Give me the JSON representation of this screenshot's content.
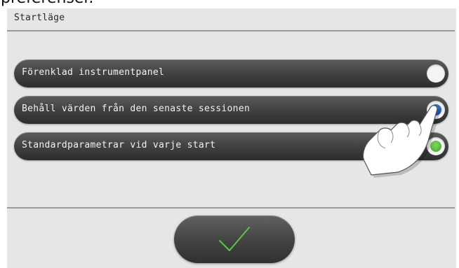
{
  "caption_fragment": "preferenser.",
  "panel": {
    "title": "Startläge"
  },
  "options": [
    {
      "label": "Förenklad instrumentpanel",
      "state": "unselected"
    },
    {
      "label": "Behåll värden från den senaste sessionen",
      "state": "pressed"
    },
    {
      "label": "Standardparametrar vid varje start",
      "state": "selected"
    }
  ],
  "confirm": {
    "icon": "checkmark-icon"
  },
  "colors": {
    "panel_bg": "#e6e6e6",
    "row_bg": "#444444",
    "radio_blue": "#1f5aa5",
    "radio_green": "#6cc74a",
    "check_green": "#5fc44a"
  },
  "icons": {
    "pointer": "pointing-hand-icon"
  }
}
